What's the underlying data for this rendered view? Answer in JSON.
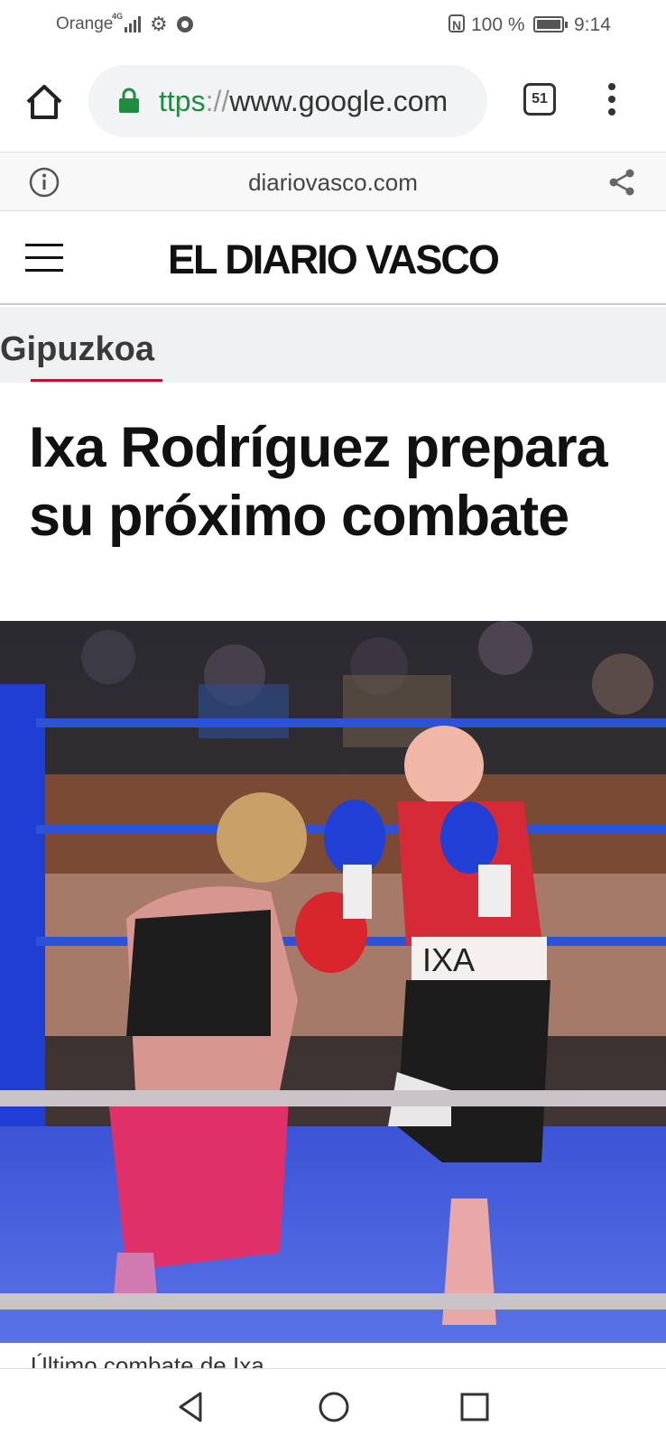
{
  "status_bar": {
    "carrier": "Orange",
    "network": "4G",
    "battery_percent": "100 %",
    "time": "9:14",
    "icons": [
      "signal-icon",
      "settings-gear-icon",
      "chrome-icon",
      "nfc-icon",
      "battery-icon"
    ]
  },
  "browser": {
    "url_scheme": "ttps",
    "url_sep": "://",
    "url_host": "www.google.com",
    "tab_count": "51",
    "icons": [
      "home-icon",
      "lock-icon",
      "tab-switcher-icon",
      "more-vert-icon"
    ]
  },
  "cct_bar": {
    "domain": "diariovasco.com",
    "icons": [
      "info-icon",
      "share-icon"
    ]
  },
  "site": {
    "logo": "EL DIARIO VASCO",
    "section": "Gipuzkoa",
    "headline": "Ixa Rodríguez prepara su próximo combate",
    "photo_trunk_text": "IXA",
    "caption": "Último combate de Ixa"
  },
  "colors": {
    "accent_green": "#1e8e3e",
    "section_red": "#c8102e",
    "ring_blue": "#1a3fd0"
  },
  "nav_bar": {
    "icons": [
      "back-icon",
      "home-circle-icon",
      "recents-icon"
    ]
  }
}
